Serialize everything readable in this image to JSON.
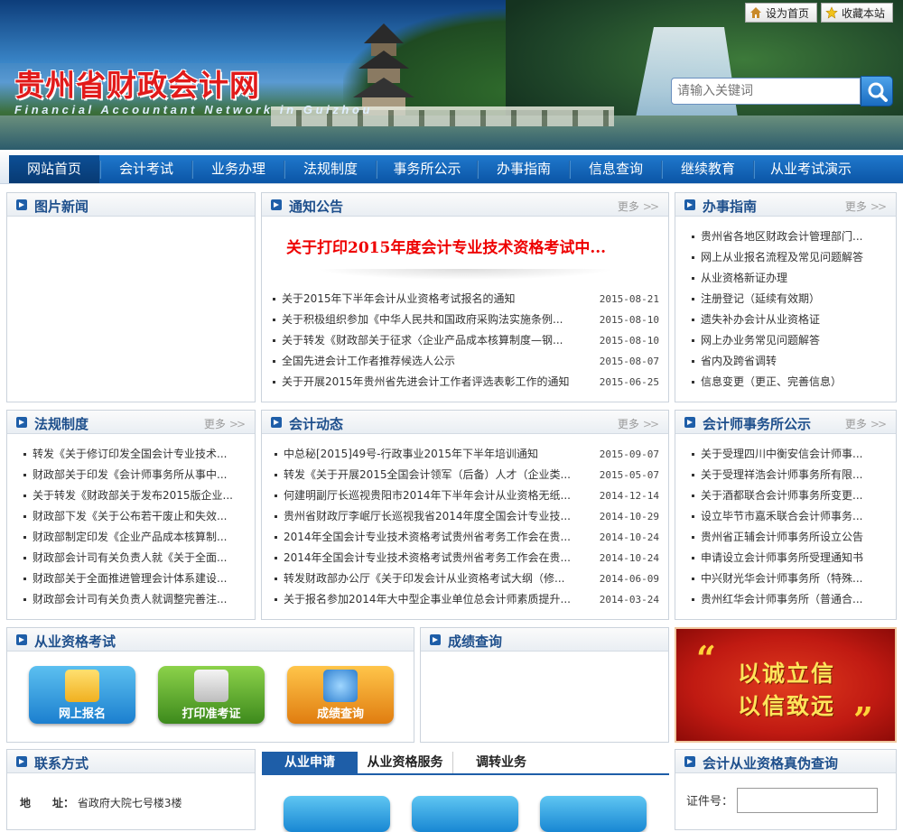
{
  "header": {
    "site_title": "贵州省财政会计网",
    "site_subtitle": "Financial Accountant Network in Guizhou",
    "set_home_label": "设为首页",
    "bookmark_label": "收藏本站",
    "search_placeholder": "请输入关键词"
  },
  "nav": {
    "items": [
      "网站首页",
      "会计考试",
      "业务办理",
      "法规制度",
      "事务所公示",
      "办事指南",
      "信息查询",
      "继续教育",
      "从业考试演示"
    ]
  },
  "more_label": "更多",
  "picture_news": {
    "title": "图片新闻"
  },
  "notices": {
    "title": "通知公告",
    "headline": "关于打印2015年度会计专业技术资格考试中...",
    "items": [
      {
        "text": "关于2015年下半年会计从业资格考试报名的通知",
        "date": "2015-08-21"
      },
      {
        "text": "关于积极组织参加《中华人民共和国政府采购法实施条例...",
        "date": "2015-08-10"
      },
      {
        "text": "关于转发《财政部关于征求〈企业产品成本核算制度—钢...",
        "date": "2015-08-10"
      },
      {
        "text": "全国先进会计工作者推荐候选人公示",
        "date": "2015-08-07"
      },
      {
        "text": "关于开展2015年贵州省先进会计工作者评选表彰工作的通知",
        "date": "2015-06-25"
      }
    ]
  },
  "guide": {
    "title": "办事指南",
    "items": [
      "贵州省各地区财政会计管理部门...",
      "网上从业报名流程及常见问题解答",
      "从业资格新证办理",
      "注册登记（延续有效期）",
      "遗失补办会计从业资格证",
      "网上办业务常见问题解答",
      "省内及跨省调转",
      "信息变更（更正、完善信息）"
    ]
  },
  "regulations": {
    "title": "法规制度",
    "items": [
      "转发《关于修订印发全国会计专业技术...",
      "财政部关于印发《会计师事务所从事中...",
      "关于转发《财政部关于发布2015版企业...",
      "财政部下发《关于公布若干废止和失效...",
      "财政部制定印发《企业产品成本核算制...",
      "财政部会计司有关负责人就《关于全面...",
      "财政部关于全面推进管理会计体系建设...",
      "财政部会计司有关负责人就调整完善注..."
    ]
  },
  "dynamics": {
    "title": "会计动态",
    "items": [
      {
        "text": "中总秘[2015]49号-行政事业2015年下半年培训通知",
        "date": "2015-09-07"
      },
      {
        "text": "转发《关于开展2015全国会计领军（后备）人才（企业类...",
        "date": "2015-05-07"
      },
      {
        "text": "何建明副厅长巡视贵阳市2014年下半年会计从业资格无纸...",
        "date": "2014-12-14"
      },
      {
        "text": "贵州省财政厅李岷厅长巡视我省2014年度全国会计专业技...",
        "date": "2014-10-29"
      },
      {
        "text": "2014年全国会计专业技术资格考试贵州省考务工作会在贵...",
        "date": "2014-10-24"
      },
      {
        "text": "2014年全国会计专业技术资格考试贵州省考务工作会在贵...",
        "date": "2014-10-24"
      },
      {
        "text": "转发财政部办公厅《关于印发会计从业资格考试大纲（修...",
        "date": "2014-06-09"
      },
      {
        "text": "关于报名参加2014年大中型企事业单位总会计师素质提升...",
        "date": "2014-03-24"
      }
    ]
  },
  "firms": {
    "title": "会计师事务所公示",
    "items": [
      "关于受理四川中衡安信会计师事...",
      "关于受理祥浩会计师事务所有限...",
      "关于酒都联合会计师事务所变更...",
      "设立毕节市嘉禾联合会计师事务...",
      "贵州省正辅会计师事务所设立公告",
      "申请设立会计师事务所受理通知书",
      "中兴财光华会计师事务所（特殊...",
      "贵州红华会计师事务所（普通合..."
    ]
  },
  "qualification_exam": {
    "title": "从业资格考试",
    "buttons": [
      "网上报名",
      "打印准考证",
      "成绩查询"
    ]
  },
  "score_query": {
    "title": "成绩查询"
  },
  "slogan": {
    "line1": "以诚立信",
    "line2": "以信致远",
    "open_quote": "“",
    "close_quote": "”"
  },
  "contact": {
    "title": "联系方式",
    "address_label": "地　　址：",
    "address_value": "省政府大院七号楼3楼"
  },
  "service_tabs": [
    "从业申请",
    "从业资格服务",
    "调转业务"
  ],
  "verify": {
    "title": "会计从业资格真伪查询",
    "id_label": "证件号："
  },
  "colors": {
    "nav_blue": "#0b55a6",
    "headline_red": "#e00000",
    "title_blue": "#1e4f8c"
  }
}
